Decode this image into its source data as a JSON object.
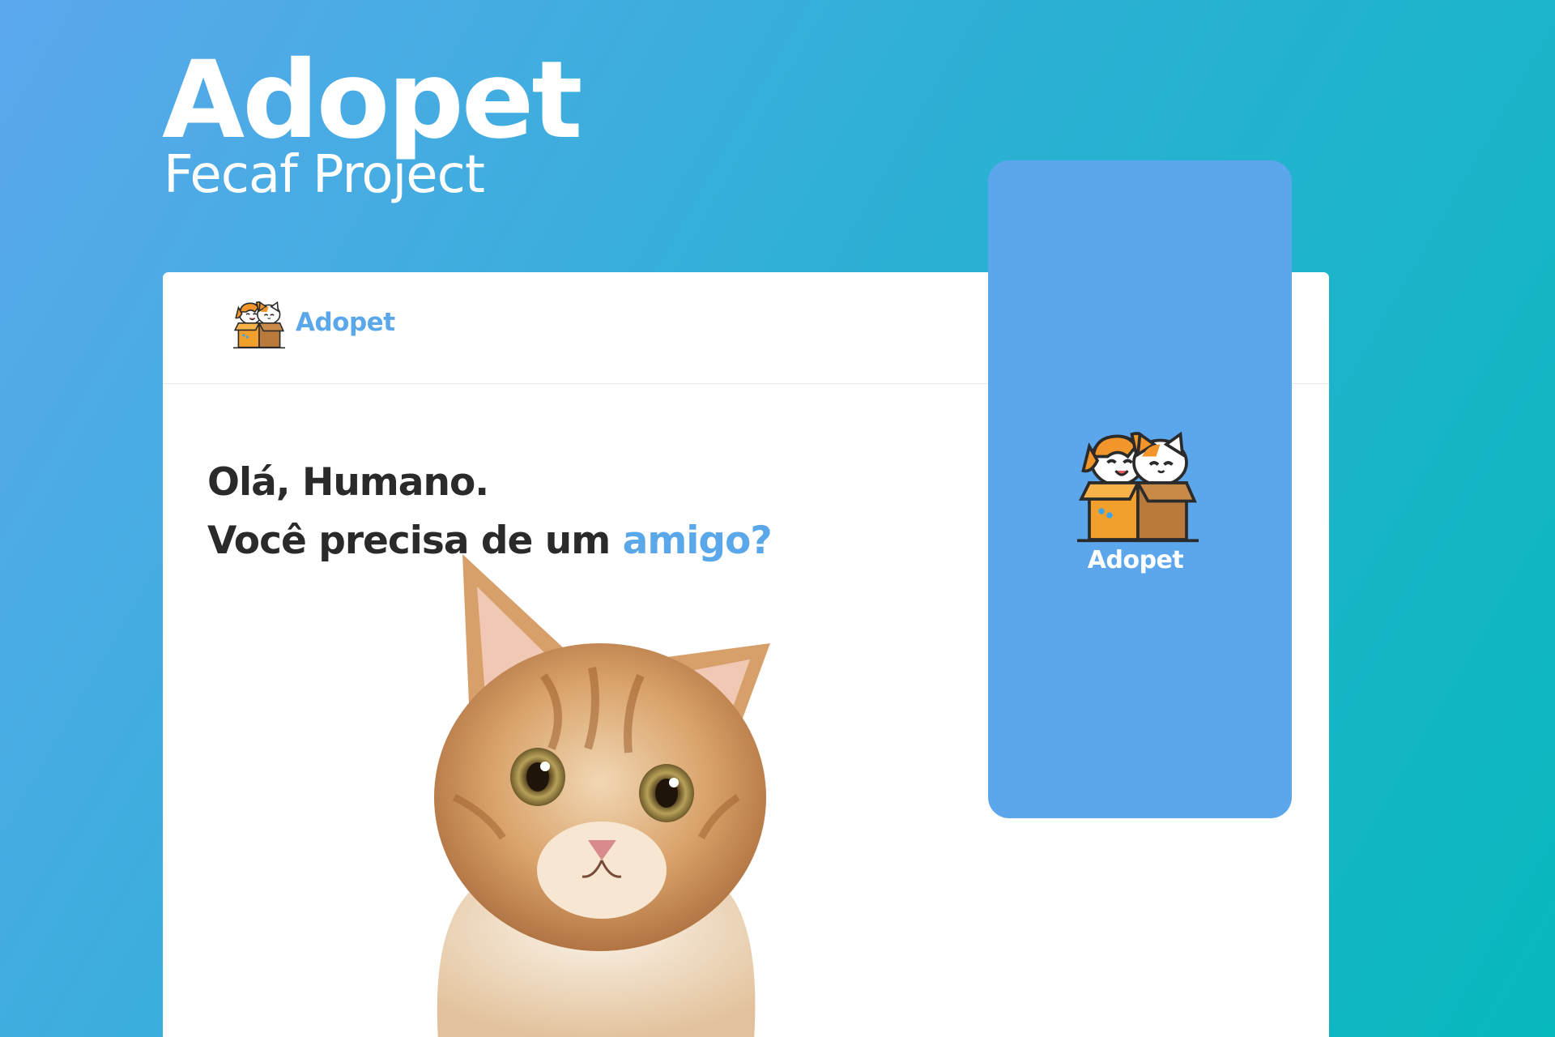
{
  "hero": {
    "title": "Adopet",
    "subtitle": "Fecaf Project"
  },
  "desktop": {
    "header": {
      "logo_icon": "dog-and-cat-in-box-icon",
      "brand": "Adopet"
    },
    "headline": {
      "line1": "Olá, Humano.",
      "line2_prefix": "Você precisa de um ",
      "line2_accent": "amigo?"
    },
    "image": "kitten-photo"
  },
  "mobile": {
    "logo_icon": "dog-and-cat-in-box-icon",
    "brand": "Adopet"
  },
  "colors": {
    "brand_blue": "#5aa8ea",
    "mobile_bg": "#5ca6ec",
    "bg_gradient_start": "#5ca8ee",
    "bg_gradient_end": "#07b8bd",
    "text_dark": "#2a2a2a",
    "box_orange": "#f2a02c",
    "box_brown": "#b97a3c"
  }
}
